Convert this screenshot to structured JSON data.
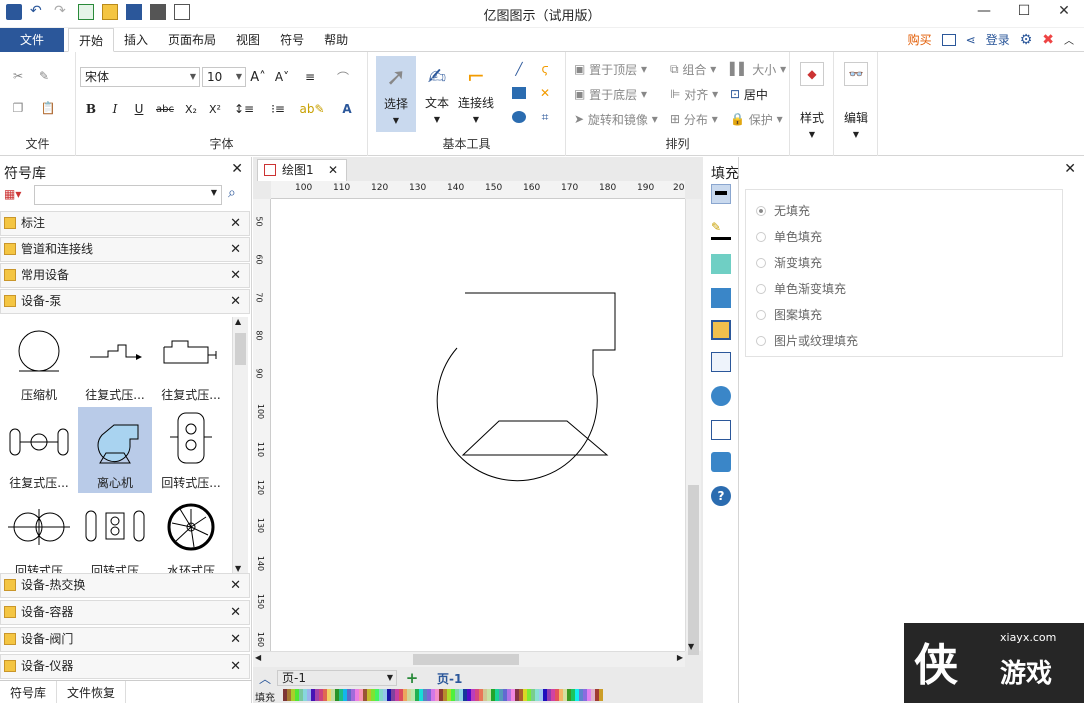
{
  "title": "亿图图示（试用版）",
  "menu": {
    "file": "文件",
    "tabs": [
      "开始",
      "插入",
      "页面布局",
      "视图",
      "符号",
      "帮助"
    ],
    "buy": "购买",
    "login": "登录"
  },
  "ribbon": {
    "groups": {
      "file": "文件",
      "font": "字体",
      "basic_tools": "基本工具",
      "arrange": "排列"
    },
    "font_name": "宋体",
    "font_size": "10",
    "select": "选择",
    "text": "文本",
    "connector": "连接线",
    "bring_front": "置于顶层",
    "send_back": "置于底层",
    "rotate_mirror": "旋转和镜像",
    "group": "组合",
    "align": "对齐",
    "distribute": "分布",
    "size": "大小",
    "center": "居中",
    "protect": "保护",
    "style": "样式",
    "edit": "编辑"
  },
  "library": {
    "title": "符号库",
    "categories_top": [
      "标注",
      "管道和连接线",
      "常用设备",
      "设备-泵"
    ],
    "symbols": [
      "压缩机",
      "往复式压...",
      "往复式压...",
      "往复式压...",
      "离心机",
      "回转式压...",
      "回转式压",
      "回转式压",
      "水环式压"
    ],
    "categories_bottom": [
      "设备-热交换",
      "设备-容器",
      "设备-阀门",
      "设备-仪器"
    ],
    "bottom_tabs": [
      "符号库",
      "文件恢复"
    ]
  },
  "document": {
    "tab": "绘图1",
    "hruler": [
      "100",
      "110",
      "120",
      "130",
      "140",
      "150",
      "160",
      "170",
      "180",
      "190",
      "20"
    ],
    "vruler": [
      "50",
      "60",
      "70",
      "80",
      "90",
      "100",
      "110",
      "120",
      "130",
      "140",
      "150",
      "160"
    ],
    "page_name": "页-1",
    "page_tab": "页-1",
    "fill_label": "填充"
  },
  "fill_panel": {
    "title": "填充",
    "options": [
      "无填充",
      "单色填充",
      "渐变填充",
      "单色渐变填充",
      "图案填充",
      "图片或纹理填充"
    ]
  },
  "watermark": {
    "site": "xiayx.com",
    "text": "游戏"
  }
}
